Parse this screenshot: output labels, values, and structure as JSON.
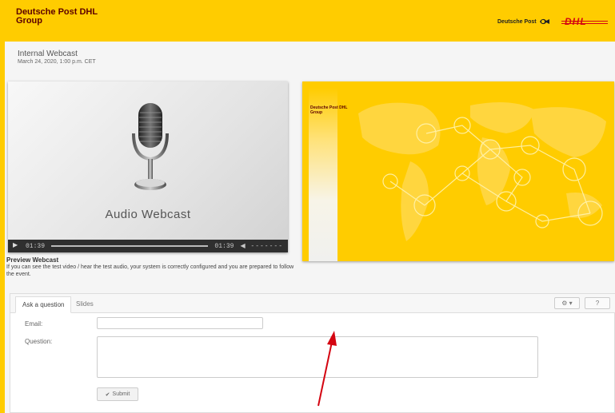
{
  "header": {
    "brand_line1": "Deutsche Post DHL",
    "brand_line2": "Group",
    "dp_logo_text": "Deutsche Post",
    "dhl_logo_text": "DHL",
    "brand_color": "#ffcc00",
    "dhl_red": "#d40511"
  },
  "event": {
    "title": "Internal Webcast",
    "subtitle": "March 24, 2020, 1:00 p.m. CET"
  },
  "player": {
    "label": "Audio Webcast",
    "time_current": "01:39",
    "time_total": "01:39",
    "volume_glyph": "◀ -------",
    "play_icon": "play-icon",
    "progress": 1.0
  },
  "slides": {
    "brand_line1": "Deutsche Post DHL",
    "brand_line2": "Group"
  },
  "preview": {
    "title": "Preview Webcast",
    "text": "If you can see the test video / hear the test audio, your system is correctly configured and you are prepared to follow the event."
  },
  "qa_panel": {
    "tabs": [
      {
        "label": "Ask a question",
        "active": true
      },
      {
        "label": "Slides",
        "active": false
      }
    ],
    "gear_label": "⚙ ▾",
    "help_label": "?",
    "email_label": "Email:",
    "email_value": "",
    "question_label": "Question:",
    "question_value": "",
    "submit_label": "Submit"
  },
  "annotation": {
    "arrow_color": "#d40511"
  }
}
